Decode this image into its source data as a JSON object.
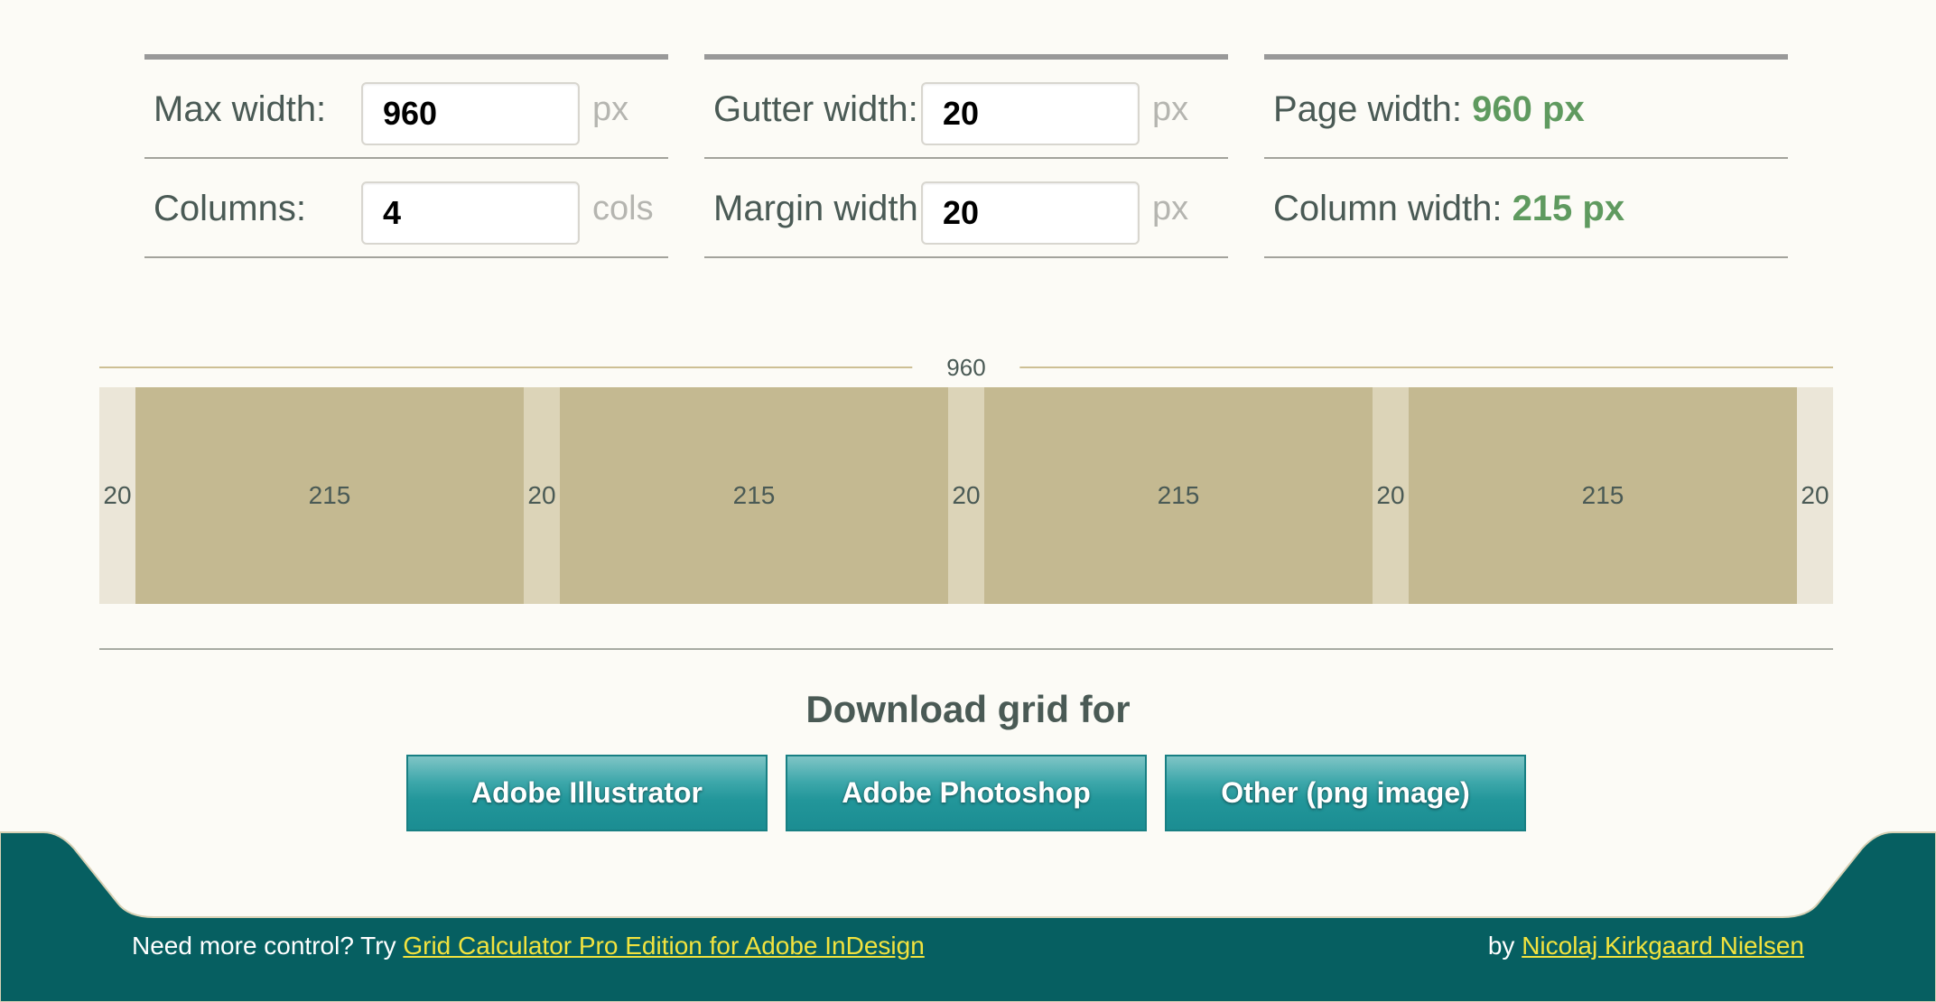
{
  "settings": {
    "max_width": {
      "label": "Max width:",
      "value": "960",
      "unit": "px"
    },
    "columns": {
      "label": "Columns:",
      "value": "4",
      "unit": "cols"
    },
    "gutter_width": {
      "label": "Gutter width:",
      "value": "20",
      "unit": "px"
    },
    "margin_width": {
      "label": "Margin width:",
      "value": "20",
      "unit": "px"
    }
  },
  "results": {
    "page_width": {
      "label": "Page width:",
      "value": "960 px"
    },
    "column_width": {
      "label": "Column width:",
      "value": "215 px"
    }
  },
  "grid": {
    "total": "960",
    "margin_left": "20",
    "gutters": [
      "20",
      "20",
      "20"
    ],
    "columns": [
      "215",
      "215",
      "215",
      "215"
    ],
    "margin_right": "20"
  },
  "download": {
    "title": "Download grid for",
    "buttons": [
      "Adobe Illustrator",
      "Adobe Photoshop",
      "Other (png image)"
    ]
  },
  "footer": {
    "prefix": "Need more control? Try",
    "pro_link": "Grid Calculator Pro Edition for Adobe InDesign",
    "by": "by",
    "author_link": "Nicolaj Kirkgaard Nielsen"
  },
  "colors": {
    "background": "#fcfbf6",
    "accent_teal": "#22969a",
    "footer_teal": "#065f61",
    "result_green": "#5f9a5f",
    "link_yellow": "#f2e33e",
    "column_fill": "#c4b991",
    "gutter_fill": "#dcd4b8",
    "margin_fill": "#ebe6d8"
  }
}
